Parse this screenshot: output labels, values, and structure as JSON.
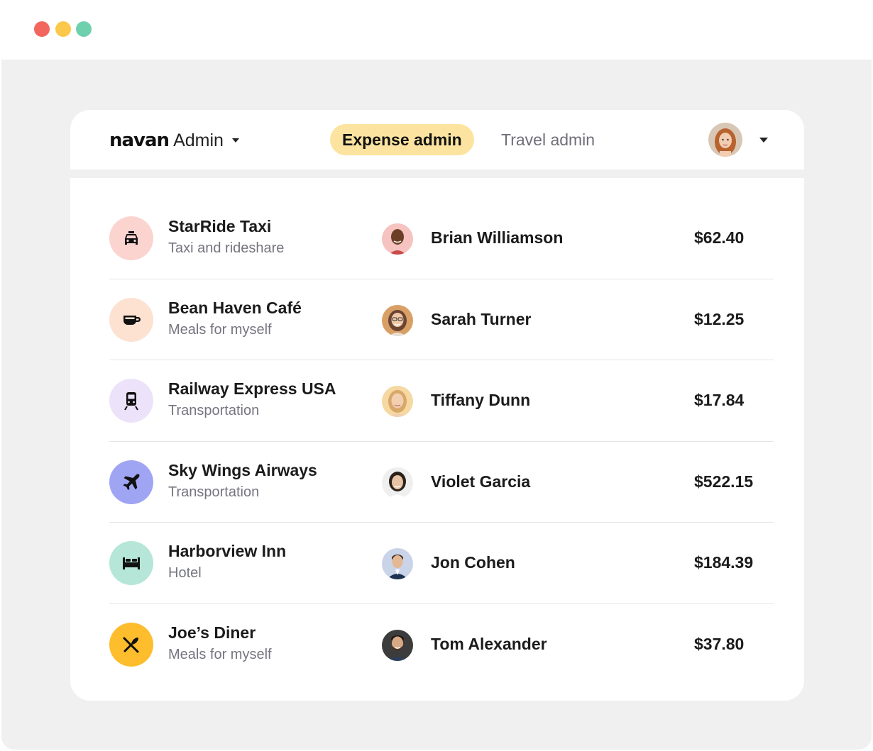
{
  "window": {
    "controls": [
      {
        "name": "close",
        "color": "#f2665e"
      },
      {
        "name": "minimize",
        "color": "#fcc84b"
      },
      {
        "name": "maximize",
        "color": "#6fd0ad"
      }
    ]
  },
  "header": {
    "brand": "navan",
    "brand_suffix": "Admin",
    "tabs": [
      {
        "label": "Expense admin",
        "active": true
      },
      {
        "label": "Travel admin",
        "active": false
      }
    ]
  },
  "expenses": [
    {
      "merchant": "StarRide Taxi",
      "category": "Taxi and rideshare",
      "icon": "taxi-icon",
      "icon_bg": "#fbd3cf",
      "employee": "Brian Williamson",
      "avatar_skin": "#6b3f26",
      "avatar_bg": "#f6c3c0",
      "amount": "$62.40"
    },
    {
      "merchant": "Bean Haven Café",
      "category": "Meals for myself",
      "icon": "coffee-cup-icon",
      "icon_bg": "#fde1d1",
      "employee": "Sarah Turner",
      "avatar_skin": "#f0c8a8",
      "avatar_bg": "#d9a066",
      "amount": "$12.25"
    },
    {
      "merchant": "Railway Express USA",
      "category": "Transportation",
      "icon": "train-icon",
      "icon_bg": "#ece3fb",
      "employee": "Tiffany Dunn",
      "avatar_skin": "#f3cfb2",
      "avatar_bg": "#f5d8a2",
      "amount": "$17.84"
    },
    {
      "merchant": "Sky Wings Airways",
      "category": "Transportation",
      "icon": "airplane-icon",
      "icon_bg": "#a0a5f3",
      "employee": "Violet Garcia",
      "avatar_skin": "#e8c3a3",
      "avatar_bg": "#efefef",
      "amount": "$522.15"
    },
    {
      "merchant": "Harborview Inn",
      "category": "Hotel",
      "icon": "bed-icon",
      "icon_bg": "#b5e6d7",
      "employee": "Jon Cohen",
      "avatar_skin": "#e3b893",
      "avatar_bg": "#c9d4e8",
      "amount": "$184.39"
    },
    {
      "merchant": "Joe’s Diner",
      "category": "Meals for myself",
      "icon": "fork-knife-icon",
      "icon_bg": "#fdbd2c",
      "employee": "Tom Alexander",
      "avatar_skin": "#d9a986",
      "avatar_bg": "#3c3c3c",
      "amount": "$37.80"
    }
  ],
  "colors": {
    "accent_tab": "#fce4a0",
    "background": "#f0f0f0",
    "card": "#ffffff"
  }
}
